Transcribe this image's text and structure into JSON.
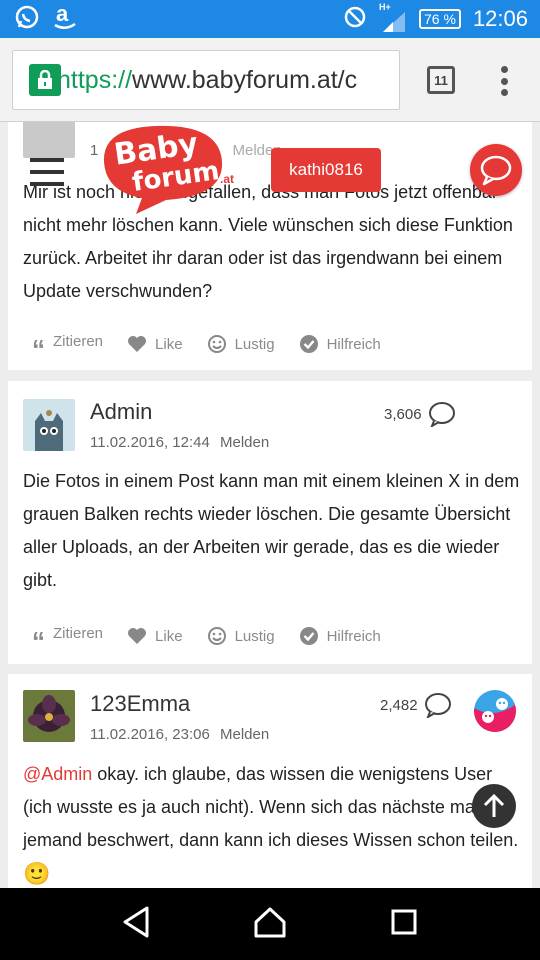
{
  "status_bar": {
    "network": "H+",
    "battery": "76 %",
    "time": "12:06"
  },
  "browser": {
    "url_scheme": "https://",
    "url_host": "www.babyforum.at/c",
    "tab_count": "11"
  },
  "header": {
    "logo_line1": "Baby",
    "logo_line2": "forum",
    "logo_suffix": ".at",
    "username": "kathi0816"
  },
  "posts": [
    {
      "date_partial": "1",
      "melden": "Melden",
      "text": "Mir ist noch nicht aufgefallen, dass man Fotos jetzt offenbar nicht mehr löschen kann. Viele wünschen sich diese Funktion zurück. Arbeitet ihr daran oder ist das irgendwann bei einem Update verschwunden?",
      "actions": {
        "quote": "Zitieren",
        "like": "Like",
        "funny": "Lustig",
        "helpful": "Hilfreich"
      }
    },
    {
      "author": "Admin",
      "count": "3,606",
      "date": "11.02.2016, 12:44",
      "melden": "Melden",
      "text": "Die Fotos in einem Post kann man mit einem kleinen X in dem grauen Balken rechts wieder löschen. Die gesamte Übersicht aller Uploads, an der Arbeiten wir gerade, das es die wieder gibt.",
      "actions": {
        "quote": "Zitieren",
        "like": "Like",
        "funny": "Lustig",
        "helpful": "Hilfreich"
      }
    },
    {
      "author": "123Emma",
      "count": "2,482",
      "date": "11.02.2016, 23:06",
      "melden": "Melden",
      "mention": "@Admin",
      "text": " okay. ich glaube, das wissen die wenigstens User (ich wusste es ja auch nicht). Wenn sich das nächste mal jemand beschwert, dann kann ich dieses Wissen schon teilen. ",
      "emoji": "🙂"
    }
  ],
  "colors": {
    "status_blue": "#1e88e5",
    "brand_red": "#e53935",
    "secure_green": "#0f9d58"
  }
}
